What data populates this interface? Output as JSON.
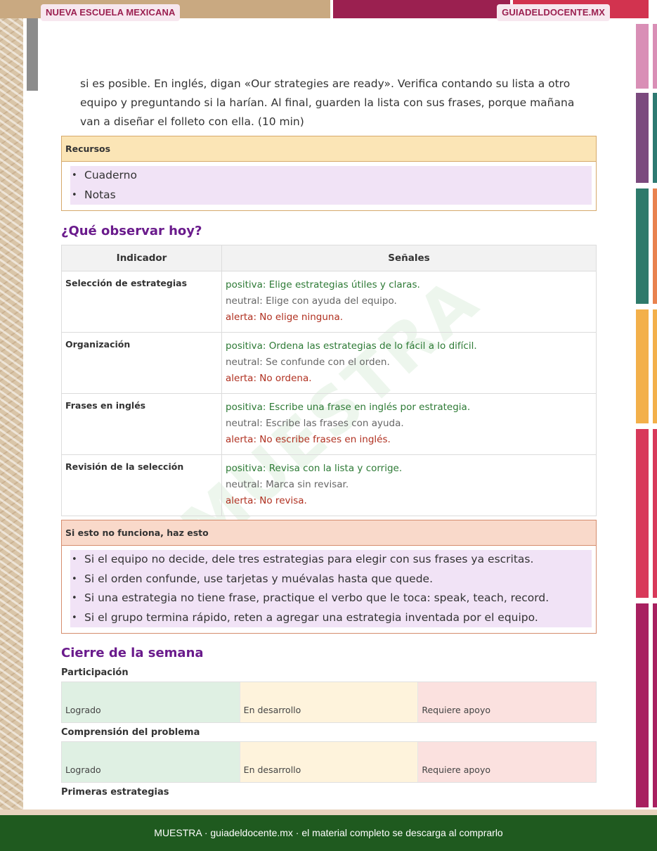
{
  "header": {
    "left_badge": "NUEVA ESCUELA MEXICANA",
    "right_badge": "GUIADELDOCENTE.MX"
  },
  "intro_text": "si es posible. En inglés, digan «Our strategies are ready». Verifica contando su lista a otro equipo y preguntando si la harían. Al final, guarden la lista con sus frases, porque mañana van a diseñar el folleto con ella. (10 min)",
  "resources": {
    "title": "Recursos",
    "items": [
      "Cuaderno",
      "Notas"
    ]
  },
  "observe": {
    "title": "¿Qué observar hoy?",
    "col_indicator": "Indicador",
    "col_signals": "Señales",
    "rows": [
      {
        "indicator": "Selección de estrategias",
        "positive": "positiva: Elige estrategias útiles y claras.",
        "neutral": "neutral: Elige con ayuda del equipo.",
        "alert": "alerta: No elige ninguna."
      },
      {
        "indicator": "Organización",
        "positive": "positiva: Ordena las estrategias de lo fácil a lo difícil.",
        "neutral": "neutral: Se confunde con el orden.",
        "alert": "alerta: No ordena."
      },
      {
        "indicator": "Frases en inglés",
        "positive": "positiva: Escribe una frase en inglés por estrategia.",
        "neutral": "neutral: Escribe las frases con ayuda.",
        "alert": "alerta: No escribe frases en inglés."
      },
      {
        "indicator": "Revisión de la selección",
        "positive": "positiva: Revisa con la lista y corrige.",
        "neutral": "neutral: Marca sin revisar.",
        "alert": "alerta: No revisa."
      }
    ]
  },
  "fallback": {
    "title": "Si esto no funciona, haz esto",
    "items": [
      "Si el equipo no decide, dele tres estrategias para elegir con sus frases ya escritas.",
      "Si el orden confunde, use tarjetas y muévalas hasta que quede.",
      "Si una estrategia no tiene frase, practique el verbo que le toca: speak, teach, record.",
      "Si el grupo termina rápido, reten a agregar una estrategia inventada por el equipo."
    ]
  },
  "closing": {
    "title": "Cierre de la semana",
    "scale_labels": [
      "Logrado",
      "En desarrollo",
      "Requiere apoyo"
    ],
    "criteria": [
      "Participación",
      "Comprensión del problema",
      "Primeras estrategias"
    ]
  },
  "watermark": "MUESTRA",
  "footer": "MUESTRA · guiadeldocente.mx · el material completo se descarga al comprarlo",
  "colors": {
    "brand_purple": "#6a1b8c",
    "brand_magenta": "#9b2050",
    "footer_green": "#1f5a1f",
    "positive": "#2d7a35",
    "alert": "#b03020"
  }
}
